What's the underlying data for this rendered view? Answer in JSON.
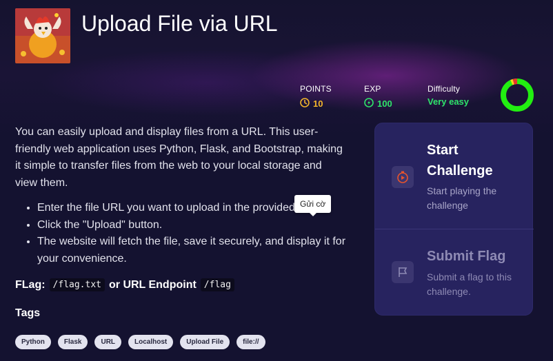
{
  "challenge": {
    "title": "Upload File via URL",
    "thumbnail_icon": "rooster-mascot-image"
  },
  "stats": {
    "points_label": "POINTS",
    "points_value": "10",
    "exp_label": "EXP",
    "exp_value": "100",
    "difficulty_label": "Difficulty",
    "difficulty_value": "Very easy",
    "difficulty_level": 0.9,
    "colors": {
      "points": "#f2b52b",
      "exp": "#2ee56a",
      "ring_green": "#22ee11",
      "ring_yellow": "#f5d21b",
      "ring_red": "#e8322c"
    }
  },
  "description": "You can easily upload and display files from a URL. This user-friendly web application uses Python, Flask, and Bootstrap, making it simple to transfer files from the web to your local storage and view them.",
  "steps": [
    "Enter the file URL you want to upload in the provided field.",
    "Click the \"Upload\" button.",
    "The website will fetch the file, save it securely, and display it for your convenience."
  ],
  "tooltip": "Gửi cờ",
  "flag_info": {
    "label": "FLag:",
    "flag_path": "/flag.txt",
    "middle": "or URL Endpoint",
    "endpoint": "/flag"
  },
  "tags_title": "Tags",
  "tags": [
    "Python",
    "Flask",
    "URL",
    "Localhost",
    "Upload File",
    "file://"
  ],
  "actions": {
    "start_title": "Start Challenge",
    "start_subtitle": "Start playing the challenge",
    "submit_title": "Submit Flag",
    "submit_subtitle": "Submit a flag to this challenge."
  }
}
